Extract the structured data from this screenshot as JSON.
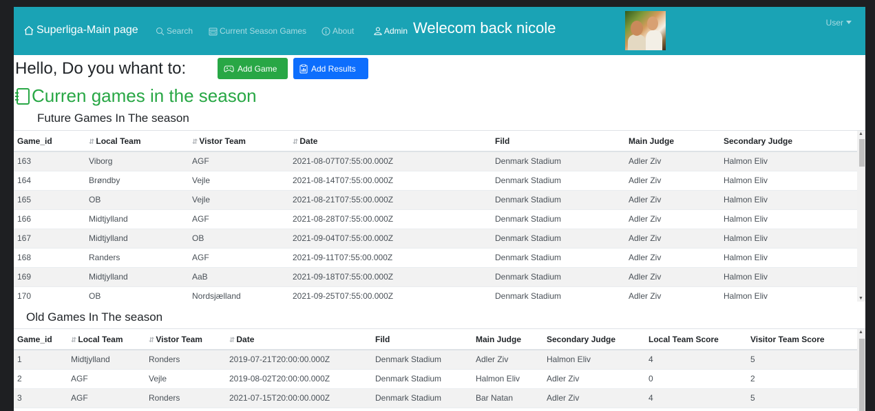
{
  "navbar": {
    "brand": "Superliga-Main page",
    "links": {
      "search": "Search",
      "current": "Current Season Games",
      "about": "About",
      "admin": "Admin"
    },
    "welcome": "Welecom back nicole",
    "user_menu": "User",
    "bg_color": "#1aa3b5"
  },
  "header": {
    "hello": "Hello, Do you whant to:",
    "add_game": "Add Game",
    "add_results": "Add Results"
  },
  "section_title": "Curren games in the season",
  "future": {
    "title": "Future Games In The season",
    "columns": [
      "Game_id",
      "Local Team",
      "Vistor Team",
      "Date",
      "Fild",
      "Main Judge",
      "Secondary Judge"
    ],
    "rows": [
      [
        "163",
        "Viborg",
        "AGF",
        "2021-08-07T07:55:00.000Z",
        "Denmark Stadium",
        "Adler Ziv",
        "Halmon Eliv"
      ],
      [
        "164",
        "Brøndby",
        "Vejle",
        "2021-08-14T07:55:00.000Z",
        "Denmark Stadium",
        "Adler Ziv",
        "Halmon Eliv"
      ],
      [
        "165",
        "OB",
        "Vejle",
        "2021-08-21T07:55:00.000Z",
        "Denmark Stadium",
        "Adler Ziv",
        "Halmon Eliv"
      ],
      [
        "166",
        "Midtjylland",
        "AGF",
        "2021-08-28T07:55:00.000Z",
        "Denmark Stadium",
        "Adler Ziv",
        "Halmon Eliv"
      ],
      [
        "167",
        "Midtjylland",
        "OB",
        "2021-09-04T07:55:00.000Z",
        "Denmark Stadium",
        "Adler Ziv",
        "Halmon Eliv"
      ],
      [
        "168",
        "Randers",
        "AGF",
        "2021-09-11T07:55:00.000Z",
        "Denmark Stadium",
        "Adler Ziv",
        "Halmon Eliv"
      ],
      [
        "169",
        "Midtjylland",
        "AaB",
        "2021-09-18T07:55:00.000Z",
        "Denmark Stadium",
        "Adler Ziv",
        "Halmon Eliv"
      ],
      [
        "170",
        "OB",
        "Nordsjælland",
        "2021-09-25T07:55:00.000Z",
        "Denmark Stadium",
        "Adler Ziv",
        "Halmon Eliv"
      ]
    ]
  },
  "old": {
    "title": "Old Games In The season",
    "columns": [
      "Game_id",
      "Local Team",
      "Vistor Team",
      "Date",
      "Fild",
      "Main Judge",
      "Secondary Judge",
      "Local Team Score",
      "Visitor Team Score"
    ],
    "rows": [
      [
        "1",
        "Midtjylland",
        "Ronders",
        "2019-07-21T20:00:00.000Z",
        "Denmark Stadium",
        "Adler Ziv",
        "Halmon Eliv",
        "4",
        "5"
      ],
      [
        "2",
        "AGF",
        "Vejle",
        "2019-08-02T20:00:00.000Z",
        "Denmark Stadium",
        "Halmon Eliv",
        "Adler Ziv",
        "0",
        "2"
      ],
      [
        "3",
        "AGF",
        "Ronders",
        "2021-07-15T20:00:00.000Z",
        "Denmark Stadium",
        "Bar Natan",
        "Adler Ziv",
        "4",
        "5"
      ]
    ]
  }
}
